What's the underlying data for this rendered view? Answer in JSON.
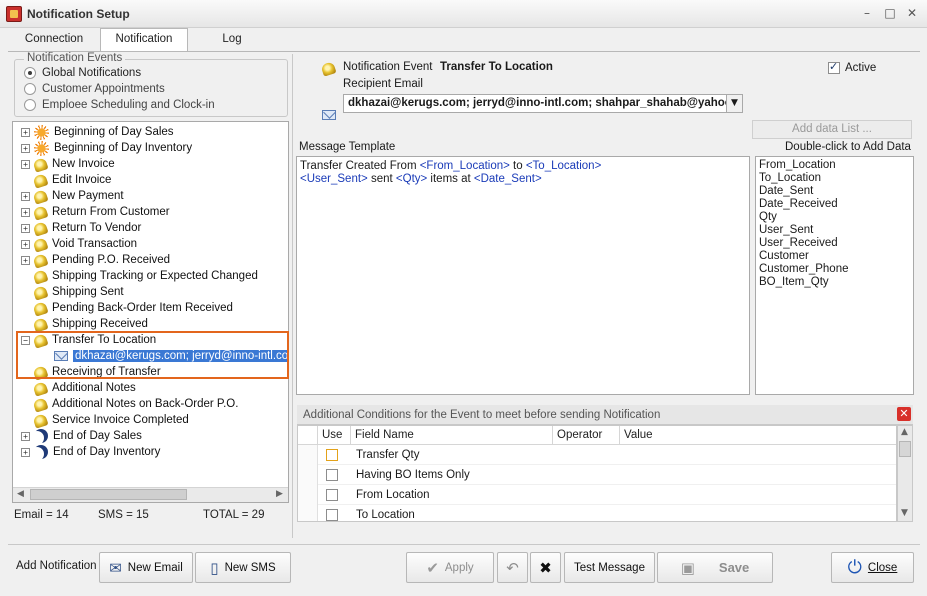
{
  "window": {
    "title": "Notification Setup"
  },
  "tabs": [
    {
      "label": "Connection"
    },
    {
      "label": "Notification"
    },
    {
      "label": "Log"
    }
  ],
  "events_group": {
    "legend": "Notification Events",
    "options": [
      {
        "label": "Global Notifications",
        "selected": true
      },
      {
        "label": "Customer Appointments",
        "selected": false
      },
      {
        "label": "Emploee Scheduling and Clock-in",
        "selected": false
      }
    ]
  },
  "tree": [
    {
      "label": "Beginning of Day Sales",
      "icon": "sun-icon",
      "expander": "+"
    },
    {
      "label": "Beginning of Day Inventory",
      "icon": "sun-icon",
      "expander": "+"
    },
    {
      "label": "New Invoice",
      "icon": "bell-icon",
      "expander": "+"
    },
    {
      "label": "Edit Invoice",
      "icon": "bell-icon",
      "expander": ""
    },
    {
      "label": "New Payment",
      "icon": "bell-icon",
      "expander": "+"
    },
    {
      "label": "Return From Customer",
      "icon": "bell-icon",
      "expander": "+"
    },
    {
      "label": "Return To Vendor",
      "icon": "bell-icon",
      "expander": "+"
    },
    {
      "label": "Void Transaction",
      "icon": "bell-icon",
      "expander": "+"
    },
    {
      "label": "Pending P.O. Received",
      "icon": "bell-icon",
      "expander": "+"
    },
    {
      "label": "Shipping Tracking or Expected Changed",
      "icon": "bell-icon",
      "expander": ""
    },
    {
      "label": "Shipping Sent",
      "icon": "bell-icon",
      "expander": ""
    },
    {
      "label": "Pending Back-Order Item Received",
      "icon": "bell-icon",
      "expander": ""
    },
    {
      "label": "Shipping Received",
      "icon": "bell-icon",
      "expander": ""
    },
    {
      "label": "Transfer To Location",
      "icon": "bell-icon",
      "expander": "−"
    },
    {
      "label": "dkhazai@kerugs.com; jerryd@inno-intl.com;",
      "icon": "mail-icon",
      "expander": "child"
    },
    {
      "label": "Receiving of Transfer",
      "icon": "bell-icon",
      "expander": ""
    },
    {
      "label": "Additional Notes",
      "icon": "bell-icon",
      "expander": ""
    },
    {
      "label": "Additional Notes on Back-Order P.O.",
      "icon": "bell-icon",
      "expander": ""
    },
    {
      "label": "Service Invoice Completed",
      "icon": "bell-icon",
      "expander": ""
    },
    {
      "label": "End of Day Sales",
      "icon": "moon-icon",
      "expander": "+"
    },
    {
      "label": "End of Day Inventory",
      "icon": "moon-icon",
      "expander": "+"
    }
  ],
  "status": {
    "email": "Email = 14",
    "sms": "SMS = 15",
    "total": "TOTAL = 29"
  },
  "event": {
    "label": "Notification Event",
    "name": "Transfer To Location",
    "active_label": "Active",
    "active": true,
    "recipient_label": "Recipient Email",
    "recipient_value": "dkhazai@kerugs.com; jerryd@inno-intl.com; shahpar_shahab@yahoo.com"
  },
  "template": {
    "label": "Message Template",
    "line1": [
      {
        "text": "Transfer Created From ",
        "tag": false
      },
      {
        "text": "<From_Location>",
        "tag": true
      },
      {
        "text": " to ",
        "tag": false
      },
      {
        "text": "<To_Location>",
        "tag": true
      }
    ],
    "line2": [
      {
        "text": "<User_Sent>",
        "tag": true
      },
      {
        "text": " sent ",
        "tag": false
      },
      {
        "text": "<Qty>",
        "tag": true
      },
      {
        "text": " items at ",
        "tag": false
      },
      {
        "text": "<Date_Sent>",
        "tag": true
      }
    ]
  },
  "data_list": {
    "add_button": "Add data List ...",
    "hint": "Double-click to Add Data",
    "fields": [
      "From_Location",
      "To_Location",
      "Date_Sent",
      "Date_Received",
      "Qty",
      "User_Sent",
      "User_Received",
      "Customer",
      "Customer_Phone",
      "BO_Item_Qty"
    ]
  },
  "conditions": {
    "header": "Additional Conditions for the Event to meet before sending Notification",
    "columns": [
      "Use",
      "Field Name",
      "Operator",
      "Value"
    ],
    "rows": [
      {
        "field": "Transfer Qty",
        "use": false
      },
      {
        "field": "Having BO Items Only",
        "use": false
      },
      {
        "field": "From Location",
        "use": false
      },
      {
        "field": "To Location",
        "use": false
      }
    ]
  },
  "toolbar": {
    "add_notification": "Add Notification",
    "new_email": "New Email",
    "new_sms": "New SMS",
    "apply": "Apply",
    "test_message": "Test Message",
    "save": "Save",
    "close": "Close"
  },
  "colors": {
    "accent": "#e3661d",
    "selection": "#3a78d4",
    "tag": "#1a3bb8"
  }
}
